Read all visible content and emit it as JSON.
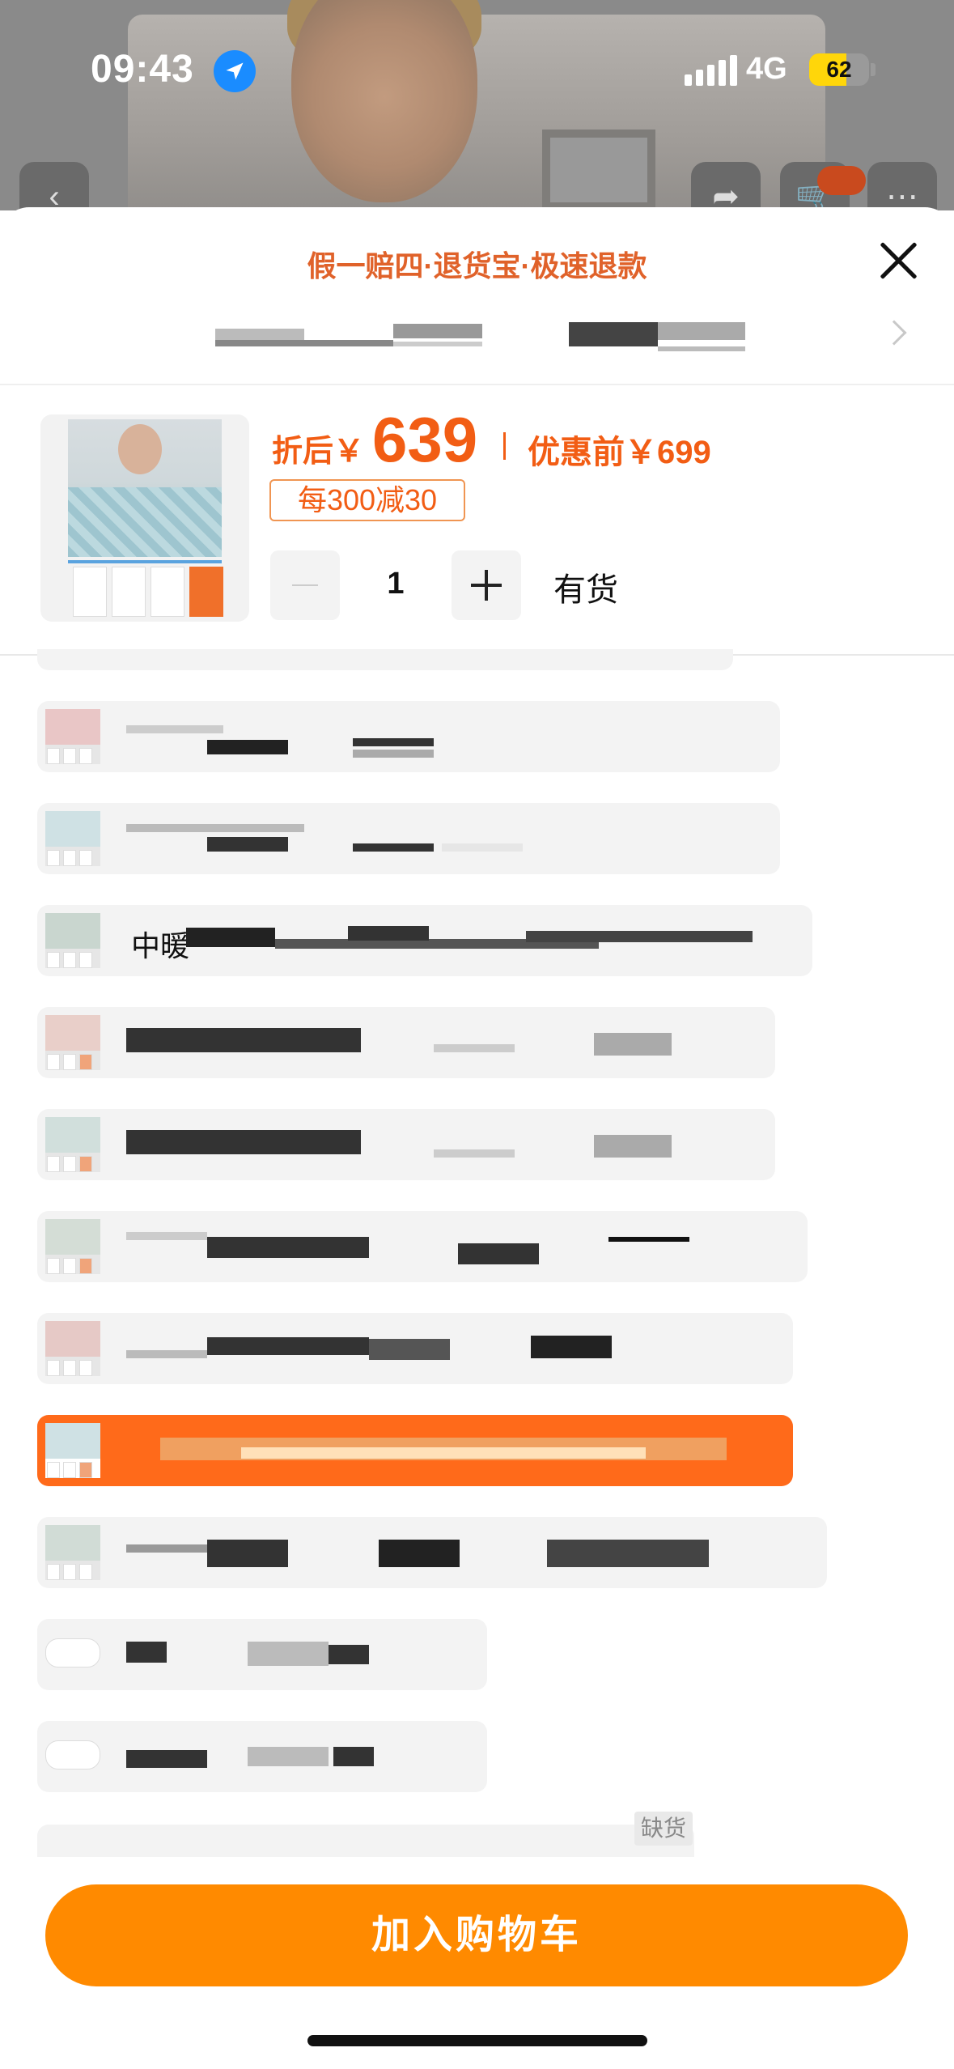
{
  "status_bar": {
    "time": "09:43",
    "network": "4G",
    "battery": "62"
  },
  "header": {
    "guarantee": "假一赔四·退货宝·极速退款"
  },
  "product": {
    "price_after_label": "折后￥",
    "price_after": "639",
    "price_before": "优惠前￥699",
    "coupon": "每300减30"
  },
  "quantity": {
    "value": "1",
    "stock": "有货"
  },
  "options": [
    {
      "label": "",
      "selected": false
    },
    {
      "label": "",
      "selected": false
    },
    {
      "label": "中暖",
      "selected": false
    },
    {
      "label": "",
      "selected": false
    },
    {
      "label": "",
      "selected": false
    },
    {
      "label": "",
      "selected": false
    },
    {
      "label": "",
      "selected": false
    },
    {
      "label": "",
      "selected": true
    },
    {
      "label": "",
      "selected": false
    },
    {
      "label": "",
      "selected": false
    },
    {
      "label": "",
      "selected": false
    }
  ],
  "out_of_stock_badge": "缺货",
  "cta": {
    "add_to_cart": "加入购物车"
  },
  "colors": {
    "accent": "#f25d14",
    "cta": "#ff8a00",
    "selected": "#ff6a1a"
  },
  "icons": [
    "location-arrow-icon",
    "back-icon",
    "share-icon",
    "cart-icon",
    "more-icon",
    "close-icon",
    "chevron-right-icon",
    "minus-icon",
    "plus-icon"
  ]
}
